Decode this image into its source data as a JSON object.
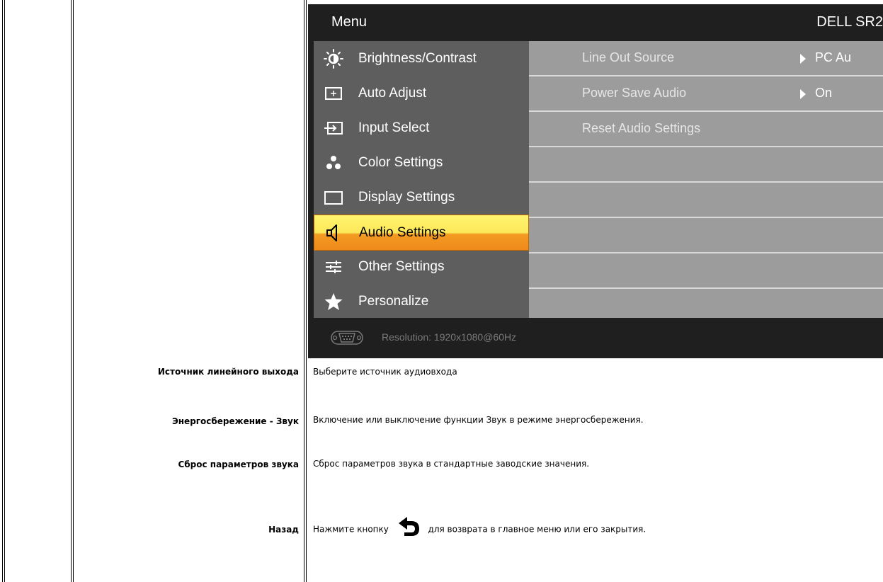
{
  "osd": {
    "title": "Menu",
    "model": "DELL SR2",
    "menu_items": [
      {
        "label": "Brightness/Contrast",
        "icon": "brightness-icon"
      },
      {
        "label": "Auto Adjust",
        "icon": "auto-adjust-icon"
      },
      {
        "label": "Input Select",
        "icon": "input-select-icon"
      },
      {
        "label": "Color Settings",
        "icon": "color-settings-icon"
      },
      {
        "label": "Display Settings",
        "icon": "display-settings-icon"
      },
      {
        "label": "Audio Settings",
        "icon": "speaker-icon",
        "selected": true
      },
      {
        "label": "Other Settings",
        "icon": "other-settings-icon"
      },
      {
        "label": "Personalize",
        "icon": "star-icon"
      }
    ],
    "submenu": [
      {
        "label": "Line Out Source",
        "value": "PC Au"
      },
      {
        "label": "Power Save Audio",
        "value": "On"
      },
      {
        "label": "Reset Audio Settings",
        "value": ""
      }
    ],
    "footer": {
      "resolution": "Resolution:  1920x1080@60Hz"
    },
    "colors": {
      "background": "#1f1f1f",
      "menu_bg": "#5e5e5e",
      "submenu_bg": "#9c9c9c",
      "highlight_top": "#fde85a",
      "highlight_bottom": "#f08a1a"
    }
  },
  "table": {
    "rows": [
      {
        "term": "Источник линейного выхода",
        "desc": "Выберите источник аудиовхода"
      },
      {
        "term": "Энергосбережение - Звук",
        "desc": "Включение или выключение функции Звук в режиме энергосбережения."
      },
      {
        "term": "Сброс параметров звука",
        "desc": "Сброс параметров звука в стандартные заводские значения."
      },
      {
        "term": "Назад",
        "desc_before": "Нажмите кнопку",
        "desc_after": "для возврата в главное меню или его закрытия.",
        "icon": "back-arrow-icon"
      }
    ]
  }
}
